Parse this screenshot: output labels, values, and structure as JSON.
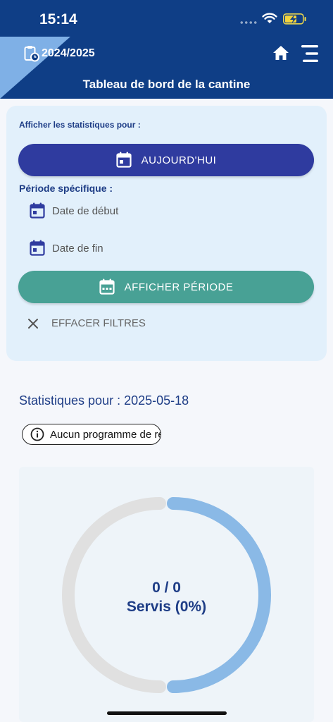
{
  "status_bar": {
    "time": "15:14"
  },
  "header": {
    "year": "2024/2025",
    "title": "Tableau de bord de la cantine"
  },
  "filters": {
    "heading": "Afficher les statistiques pour :",
    "today_button": "AUJOURD'HUI",
    "period_label": "Période spécifique :",
    "start_date_placeholder": "Date de début",
    "end_date_placeholder": "Date de fin",
    "show_period_button": "AFFICHER PÉRIODE",
    "clear_button": "EFFACER FILTRES"
  },
  "stats": {
    "title": "Statistiques pour : 2025-05-18",
    "info_chip": "Aucun programme de repas"
  },
  "gauge": {
    "value_text": "0 / 0",
    "label_text": "Servis (0%)",
    "served": 0,
    "total": 0,
    "percent": 0
  },
  "colors": {
    "header_bg": "#0f3e86",
    "today_button": "#2f3b9f",
    "period_button": "#48a195",
    "gauge_track": "#e0e0e0",
    "gauge_arc": "#8ab9e6"
  }
}
